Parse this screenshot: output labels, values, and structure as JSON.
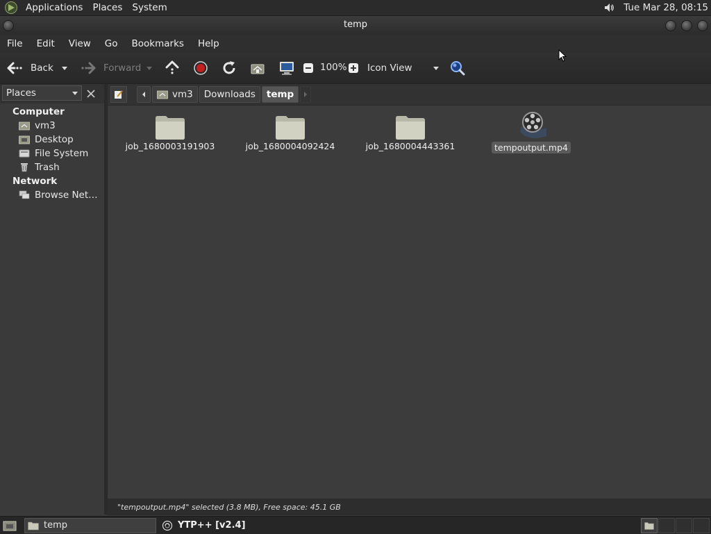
{
  "top_panel": {
    "menus": [
      "Applications",
      "Places",
      "System"
    ],
    "clock": "Tue Mar 28, 08:15"
  },
  "window": {
    "title": "temp"
  },
  "menubar": [
    "File",
    "Edit",
    "View",
    "Go",
    "Bookmarks",
    "Help"
  ],
  "toolbar": {
    "back": "Back",
    "forward": "Forward",
    "zoom": "100%",
    "view_mode": "Icon View"
  },
  "sidebar": {
    "header": "Places",
    "computer_heading": "Computer",
    "computer_items": [
      "vm3",
      "Desktop",
      "File System",
      "Trash"
    ],
    "network_heading": "Network",
    "network_items": [
      "Browse Net…"
    ]
  },
  "pathbar": {
    "crumbs": [
      "vm3",
      "Downloads",
      "temp"
    ]
  },
  "files": [
    {
      "name": "job_1680003191903",
      "type": "folder"
    },
    {
      "name": "job_1680004092424",
      "type": "folder"
    },
    {
      "name": "job_1680004443361",
      "type": "folder"
    },
    {
      "name": "tempoutput.mp4",
      "type": "video",
      "selected": true
    }
  ],
  "statusbar": {
    "text": "\"tempoutput.mp4\" selected (3.8 MB), Free space: 45.1 GB"
  },
  "taskbar": {
    "tasks": [
      "temp",
      "YTP++ [v2.4]"
    ]
  },
  "icons": {
    "distro": "distro-logo-icon",
    "volume": "speaker-icon",
    "back": "arrow-left-icon",
    "forward": "arrow-right-icon",
    "up": "arrow-up-icon",
    "stop": "stop-icon",
    "reload": "reload-icon",
    "home": "home-icon",
    "computer": "computer-icon",
    "zoom_out": "zoom-out-icon",
    "zoom_in": "zoom-in-icon",
    "search": "search-icon"
  }
}
